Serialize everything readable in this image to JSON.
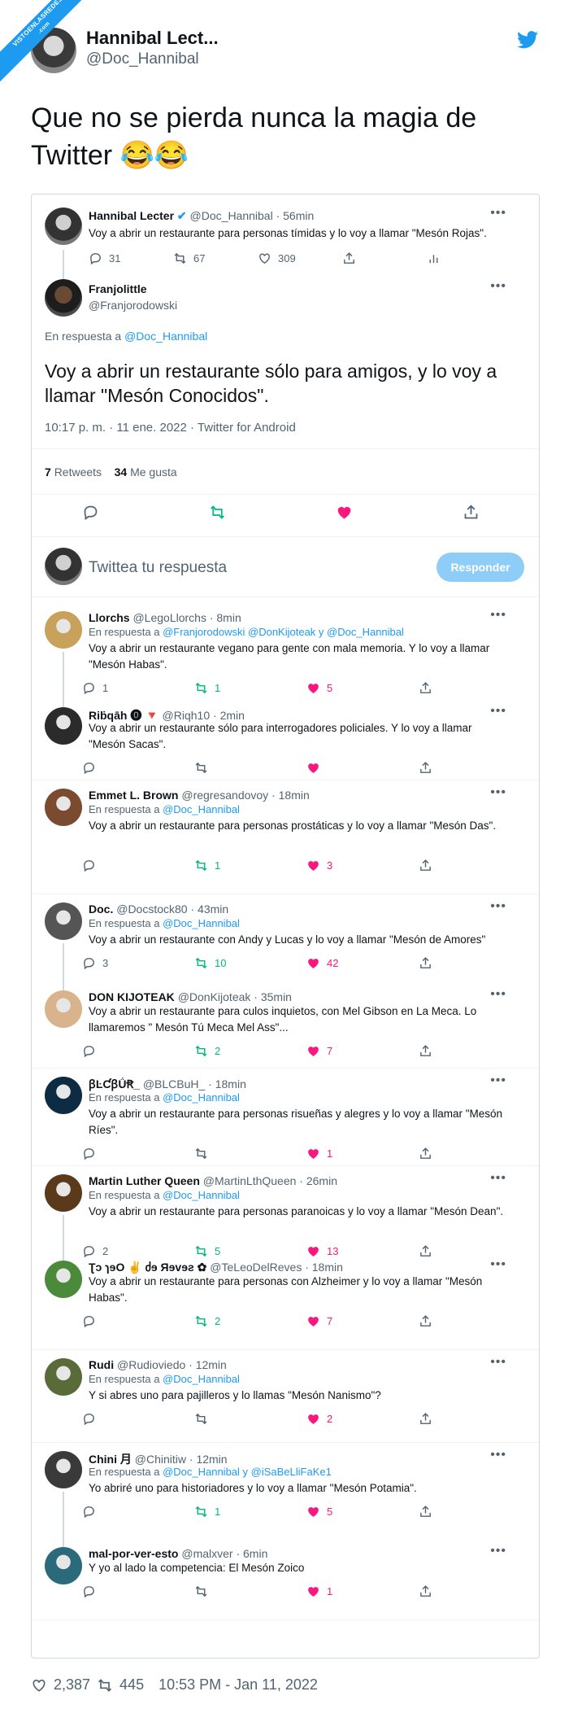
{
  "watermark": {
    "line1": "VISTOENLASREDES",
    "line2": ".com"
  },
  "outer": {
    "name": "Hannibal Lect...",
    "handle": "@Doc_Hannibal",
    "text": "Que no se pierda nunca la magia de Twitter 😂😂"
  },
  "parent": {
    "name": "Hannibal Lecter",
    "handle": "@Doc_Hannibal · 56min",
    "text": "Voy a abrir un restaurante para personas tímidas y lo voy a llamar \"Mesón Rojas\".",
    "replies": "31",
    "retweets": "67",
    "likes": "309"
  },
  "focus": {
    "name": "Franjolittle",
    "handle": "@Franjorodowski",
    "reply_prefix": "En respuesta a ",
    "reply_to": "@Doc_Hannibal",
    "text": "Voy a abrir un restaurante sólo para amigos, y lo voy a llamar \"Mesón Conocidos\".",
    "meta": "10:17 p. m. · 11 ene. 2022 · Twitter for Android",
    "retweets_count": "7",
    "retweets_label": "Retweets",
    "likes_count": "34",
    "likes_label": "Me gusta"
  },
  "reply_box": {
    "placeholder": "Twittea tu respuesta",
    "button": "Responder"
  },
  "replies": [
    {
      "name": "Llorchs",
      "handle": "@LegoLlorchs · 8min",
      "reply_prefix": "En respuesta a ",
      "reply_to": "@Franjorodowski @DonKijoteak y @Doc_Hannibal",
      "text": "Voy a abrir un restaurante vegano para gente con mala memoria. Y lo voy a llamar \"Mesón Habas\".",
      "replies": "1",
      "retweets": "1",
      "likes": "5"
    },
    {
      "name": "Riḃqāh ⓿ 🔻",
      "handle": "@Riqh10 · 2min",
      "reply_prefix": "",
      "reply_to": "",
      "text": "Voy a abrir un restaurante sólo para interrogadores policiales. Y lo voy a llamar \"Mesón Sacas\".",
      "replies": "",
      "retweets": "",
      "likes": ""
    },
    {
      "name": "Emmet L. Brown",
      "handle": "@regresandovoy · 18min",
      "reply_prefix": "En respuesta a ",
      "reply_to": "@Doc_Hannibal",
      "text": "Voy a abrir un restaurante para personas prostáticas y lo voy a llamar \"Mesón Das\".",
      "replies": "",
      "retweets": "1",
      "likes": "3"
    },
    {
      "name": "Doc.",
      "handle": "@Docstock80 · 43min",
      "reply_prefix": "En respuesta a ",
      "reply_to": "@Doc_Hannibal",
      "text": "Voy a abrir un restaurante con Andy y Lucas y lo voy a llamar \"Mesón de Amores\"",
      "replies": "3",
      "retweets": "10",
      "likes": "42"
    },
    {
      "name": "DON KIJOTEAK",
      "handle": "@DonKijoteak · 35min",
      "reply_prefix": "",
      "reply_to": "",
      "text": "Voy a abrir un restaurante para culos inquietos, con Mel Gibson en La Meca. Lo llamaremos \" Mesón Tú Meca Mel Ass\"...",
      "replies": "",
      "retweets": "2",
      "likes": "7"
    },
    {
      "name": "ꞵĿƇꞵǗꞦ_",
      "handle": "@BLCBuH_ · 18min",
      "reply_prefix": "En respuesta a ",
      "reply_to": "@Doc_Hannibal",
      "text": "Voy a abrir un restaurante para personas risueñas y alegres y lo voy a llamar \"Mesón Ríes\".",
      "replies": "",
      "retweets": "",
      "likes": "1"
    },
    {
      "name": "Martin Luther Queen",
      "handle": "@MartinLthQueen · 26min",
      "reply_prefix": "En respuesta a ",
      "reply_to": "@Doc_Hannibal",
      "text": "Voy a abrir un restaurante para personas paranoicas y lo voy a llamar \"Mesón Dean\".",
      "replies": "2",
      "retweets": "5",
      "likes": "13"
    },
    {
      "name": "Ʈɔ ɿɘO ✌ ძɘ Яɘvɘƨ ✿",
      "handle": "@TeLeoDelReves · 18min",
      "reply_prefix": "",
      "reply_to": "",
      "text": "Voy a abrir un restaurante para personas con Alzheimer y lo voy a llamar \"Mesón Habas\".",
      "replies": "",
      "retweets": "2",
      "likes": "7"
    },
    {
      "name": "Rudi",
      "handle": "@Rudioviedo · 12min",
      "reply_prefix": "En respuesta a ",
      "reply_to": "@Doc_Hannibal",
      "text": "Y si abres uno para pajilleros y lo llamas \"Mesón Nanismo\"?",
      "replies": "",
      "retweets": "",
      "likes": "2"
    },
    {
      "name": "Chini 月",
      "handle": "@Chinitiw · 12min",
      "reply_prefix": "En respuesta a ",
      "reply_to": "@Doc_Hannibal y @iSaBeLliFaKe1",
      "text": "Yo abriré uno para historiadores y lo voy a llamar \"Mesón Potamia\".",
      "replies": "",
      "retweets": "1",
      "likes": "5"
    },
    {
      "name": "mal-por-ver-esto",
      "handle": "@malxver · 6min",
      "reply_prefix": "",
      "reply_to": "",
      "text": "Y yo al lado la competencia: El Mesón Zoico",
      "replies": "",
      "retweets": "",
      "likes": "1"
    }
  ],
  "footer": {
    "likes": "2,387",
    "retweets": "445",
    "timestamp": "10:53 PM - Jan 11, 2022"
  },
  "colors": {
    "accent": "#1d9bf0",
    "retweet": "#00ba7c",
    "like": "#f91880",
    "muted": "#536471"
  }
}
